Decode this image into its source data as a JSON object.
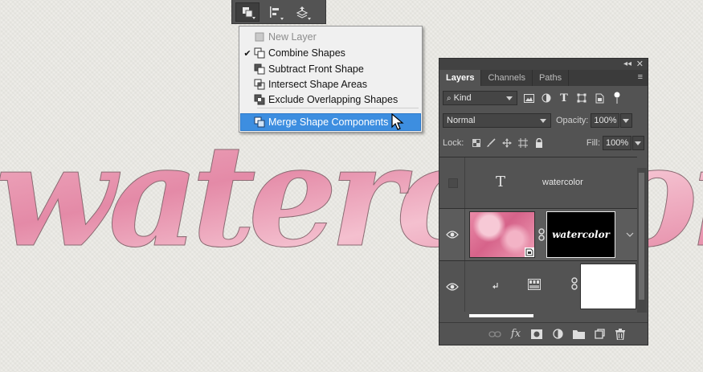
{
  "canvas": {
    "art_text": "watercolor",
    "art_colors": {
      "light": "#f4c0cf",
      "mid": "#e892ad",
      "deep": "#d96a8f",
      "outline": "#7a5b63"
    }
  },
  "toolbar": {
    "buttons": [
      {
        "icon": "path-operations-icon",
        "active": true
      },
      {
        "icon": "path-alignment-icon",
        "active": false
      },
      {
        "icon": "path-arrangement-icon",
        "active": false
      }
    ]
  },
  "menu": {
    "items": [
      {
        "label": "New Layer",
        "checked": false,
        "disabled": true,
        "selected": false,
        "icon": "new-layer-icon"
      },
      {
        "label": "Combine Shapes",
        "checked": true,
        "disabled": false,
        "selected": false,
        "icon": "combine-shapes-icon"
      },
      {
        "label": "Subtract Front Shape",
        "checked": false,
        "disabled": false,
        "selected": false,
        "icon": "subtract-front-shape-icon"
      },
      {
        "label": "Intersect Shape Areas",
        "checked": false,
        "disabled": false,
        "selected": false,
        "icon": "intersect-shape-areas-icon"
      },
      {
        "label": "Exclude Overlapping Shapes",
        "checked": false,
        "disabled": false,
        "selected": false,
        "icon": "exclude-overlapping-shapes-icon"
      },
      {
        "label": "Merge Shape Components",
        "checked": false,
        "disabled": false,
        "selected": true,
        "icon": "merge-shape-components-icon"
      }
    ],
    "check_glyph": "✔"
  },
  "layers_panel": {
    "tabs": [
      {
        "label": "Layers",
        "active": true
      },
      {
        "label": "Channels",
        "active": false
      },
      {
        "label": "Paths",
        "active": false
      }
    ],
    "filter": {
      "label": "Kind"
    },
    "blend_mode": "Normal",
    "opacity_label": "Opacity:",
    "opacity_value": "100%",
    "lock_label": "Lock:",
    "fill_label": "Fill:",
    "fill_value": "100%",
    "layers": [
      {
        "name": "watercolor",
        "type": "text",
        "visible": false
      },
      {
        "name": "watercolor",
        "type": "smart-object-with-mask",
        "visible": true
      },
      {
        "name": "",
        "type": "adjustment-with-mask",
        "visible": true
      }
    ],
    "footer_icons": [
      "link-layers-icon",
      "fx-icon",
      "add-mask-icon",
      "new-adjustment-icon",
      "new-group-icon",
      "new-layer-icon",
      "delete-layer-icon"
    ],
    "colors": {
      "panel": "#535353",
      "selection": "#3d8ee0"
    }
  },
  "cursor": {
    "icon": "arrow-cursor-icon"
  }
}
